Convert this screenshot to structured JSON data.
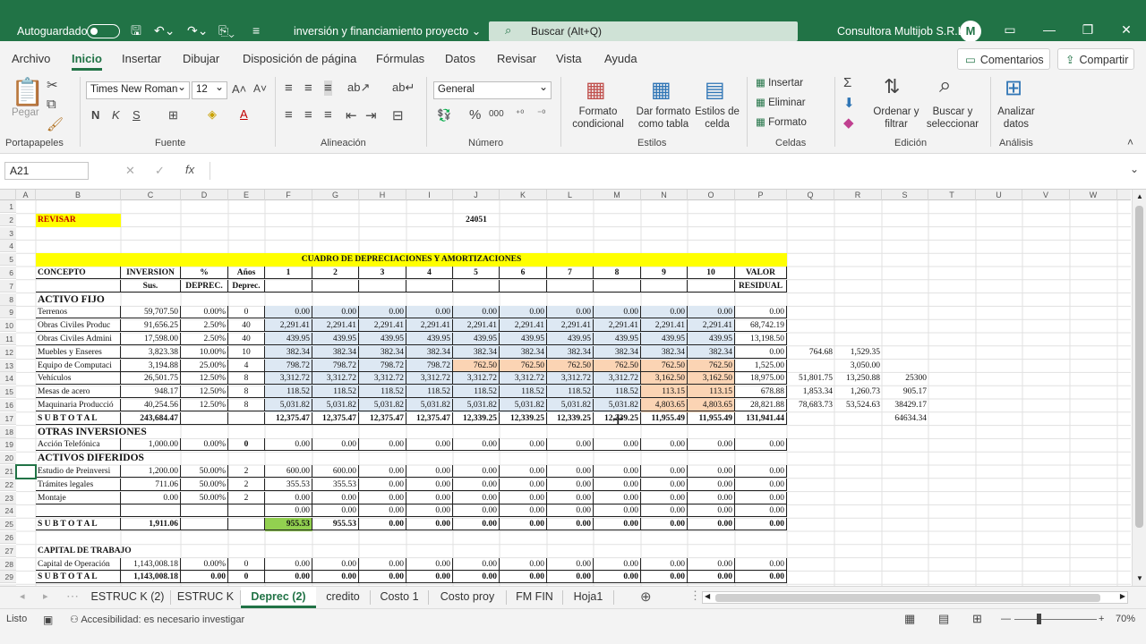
{
  "titlebar": {
    "autosave_label": "Autoguardado",
    "doc_title": "inversión y financiamiento proyecto ⌄",
    "search_placeholder": "Buscar (Alt+Q)",
    "org": "Consultora Multijob S.R.L.",
    "avatar_initial": "M"
  },
  "menu": {
    "tabs": [
      "Archivo",
      "Inicio",
      "Insertar",
      "Dibujar",
      "Disposición de página",
      "Fórmulas",
      "Datos",
      "Revisar",
      "Vista",
      "Ayuda"
    ],
    "comments": "Comentarios",
    "share": "Compartir"
  },
  "ribbon": {
    "paste": "Pegar",
    "font_name": "Times New Roman",
    "font_size": "12",
    "number_format": "General",
    "cond_format": "Formato condicional",
    "format_table": "Dar formato como tabla",
    "cell_styles": "Estilos de celda",
    "insert": "Insertar",
    "delete": "Eliminar",
    "format": "Formato",
    "sort": "Ordenar y filtrar",
    "find": "Buscar y seleccionar",
    "analyze": "Analizar datos",
    "groups": [
      "Portapapeles",
      "Fuente",
      "Alineación",
      "Número",
      "Estilos",
      "Celdas",
      "Edición",
      "Análisis"
    ]
  },
  "formula": {
    "namebox": "A21",
    "content": ""
  },
  "sheet": {
    "col_letters": [
      "A",
      "B",
      "C",
      "D",
      "E",
      "F",
      "G",
      "H",
      "I",
      "J",
      "K",
      "L",
      "M",
      "N",
      "O",
      "P",
      "Q",
      "R",
      "S",
      "T",
      "U",
      "V",
      "W"
    ],
    "row_numbers": [
      "1",
      "2",
      "3",
      "4",
      "5",
      "6",
      "7",
      "8",
      "9",
      "10",
      "11",
      "12",
      "13",
      "14",
      "15",
      "16",
      "17",
      "18",
      "19",
      "20",
      "21",
      "22",
      "23",
      "24",
      "25",
      "26",
      "27",
      "28",
      "29",
      "30"
    ],
    "revisar": "REVISAR",
    "j2": "24051",
    "title": "CUADRO DE DEPRECIACIONES Y AMORTIZACIONES",
    "header6": [
      "CONCEPTO",
      "INVERSION",
      "%",
      "Años",
      "1",
      "2",
      "3",
      "4",
      "5",
      "6",
      "7",
      "8",
      "9",
      "10",
      "VALOR"
    ],
    "header7": [
      "",
      "Sus.",
      "DEPREC.",
      "Deprec.",
      "",
      "",
      "",
      "",
      "",
      "",
      "",
      "",
      "",
      "",
      "RESIDUAL"
    ],
    "activo_fijo": "ACTIVO FIJO",
    "otras": "OTRAS INVERSIONES",
    "diferidos": "ACTIVOS DIFERIDOS",
    "capital": "CAPITAL DE TRABAJO",
    "rows": [
      {
        "r": 9,
        "cells": [
          "Terrenos",
          "59,707.50",
          "0.00%",
          "0",
          "0.00",
          "0.00",
          "0.00",
          "0.00",
          "0.00",
          "0.00",
          "0.00",
          "0.00",
          "0.00",
          "0.00",
          "0.00"
        ]
      },
      {
        "r": 10,
        "cells": [
          "Obras Civiles Produc",
          "91,656.25",
          "2.50%",
          "40",
          "2,291.41",
          "2,291.41",
          "2,291.41",
          "2,291.41",
          "2,291.41",
          "2,291.41",
          "2,291.41",
          "2,291.41",
          "2,291.41",
          "2,291.41",
          "68,742.19"
        ]
      },
      {
        "r": 11,
        "cells": [
          "Obras Civiles Admini",
          "17,598.00",
          "2.50%",
          "40",
          "439.95",
          "439.95",
          "439.95",
          "439.95",
          "439.95",
          "439.95",
          "439.95",
          "439.95",
          "439.95",
          "439.95",
          "13,198.50"
        ]
      },
      {
        "r": 12,
        "cells": [
          "Muebles y Enseres",
          "3,823.38",
          "10.00%",
          "10",
          "382.34",
          "382.34",
          "382.34",
          "382.34",
          "382.34",
          "382.34",
          "382.34",
          "382.34",
          "382.34",
          "382.34",
          "0.00"
        ],
        "extra": [
          "764.68",
          "1,529.35",
          ""
        ]
      },
      {
        "r": 13,
        "cells": [
          "Equipo de Computaci",
          "3,194.88",
          "25.00%",
          "4",
          "798.72",
          "798.72",
          "798.72",
          "798.72",
          "762.50",
          "762.50",
          "762.50",
          "762.50",
          "762.50",
          "762.50",
          "1,525.00"
        ],
        "extra": [
          "",
          "3,050.00",
          ""
        ]
      },
      {
        "r": 14,
        "cells": [
          "Vehículos",
          "26,501.75",
          "12.50%",
          "8",
          "3,312.72",
          "3,312.72",
          "3,312.72",
          "3,312.72",
          "3,312.72",
          "3,312.72",
          "3,312.72",
          "3,312.72",
          "3,162.50",
          "3,162.50",
          "18,975.00"
        ],
        "extra": [
          "51,801.75",
          "13,250.88",
          "25300"
        ]
      },
      {
        "r": 15,
        "cells": [
          "Mesas de acero",
          "948.17",
          "12.50%",
          "8",
          "118.52",
          "118.52",
          "118.52",
          "118.52",
          "118.52",
          "118.52",
          "118.52",
          "118.52",
          "113.15",
          "113.15",
          "678.88"
        ],
        "extra": [
          "1,853.34",
          "1,260.73",
          "905.17"
        ]
      },
      {
        "r": 16,
        "cells": [
          "Maquinaria Producció",
          "40,254.56",
          "12.50%",
          "8",
          "5,031.82",
          "5,031.82",
          "5,031.82",
          "5,031.82",
          "5,031.82",
          "5,031.82",
          "5,031.82",
          "5,031.82",
          "4,803.65",
          "4,803.65",
          "28,821.88"
        ],
        "extra": [
          "78,683.73",
          "53,524.63",
          "38429.17"
        ]
      },
      {
        "r": 17,
        "cells": [
          "S U B   T O T A L",
          "243,684.47",
          "",
          "",
          "12,375.47",
          "12,375.47",
          "12,375.47",
          "12,375.47",
          "12,339.25",
          "12,339.25",
          "12,339.25",
          "12,339.25",
          "11,955.49",
          "11,955.49",
          "131,941.44"
        ],
        "extra": [
          "",
          "",
          "64634.34"
        ]
      },
      {
        "r": 19,
        "cells": [
          "Acción Telefónica",
          "1,000.00",
          "0.00%",
          "0",
          "0.00",
          "0.00",
          "0.00",
          "0.00",
          "0.00",
          "0.00",
          "0.00",
          "0.00",
          "0.00",
          "0.00",
          "0.00"
        ]
      },
      {
        "r": 21,
        "cells": [
          "Estudio de Preinversi",
          "1,200.00",
          "50.00%",
          "2",
          "600.00",
          "600.00",
          "0.00",
          "0.00",
          "0.00",
          "0.00",
          "0.00",
          "0.00",
          "0.00",
          "0.00",
          "0.00"
        ]
      },
      {
        "r": 22,
        "cells": [
          "Trámites legales",
          "711.06",
          "50.00%",
          "2",
          "355.53",
          "355.53",
          "0.00",
          "0.00",
          "0.00",
          "0.00",
          "0.00",
          "0.00",
          "0.00",
          "0.00",
          "0.00"
        ]
      },
      {
        "r": 23,
        "cells": [
          "Montaje",
          "0.00",
          "50.00%",
          "2",
          "0.00",
          "0.00",
          "0.00",
          "0.00",
          "0.00",
          "0.00",
          "0.00",
          "0.00",
          "0.00",
          "0.00",
          "0.00"
        ]
      },
      {
        "r": 24,
        "cells": [
          "",
          "",
          "",
          "",
          "0.00",
          "0.00",
          "0.00",
          "0.00",
          "0.00",
          "0.00",
          "0.00",
          "0.00",
          "0.00",
          "0.00",
          "0.00"
        ]
      },
      {
        "r": 25,
        "cells": [
          "S U B   T O T A L",
          "1,911.06",
          "",
          "",
          "955.53",
          "955.53",
          "0.00",
          "0.00",
          "0.00",
          "0.00",
          "0.00",
          "0.00",
          "0.00",
          "0.00",
          "0.00"
        ]
      },
      {
        "r": 28,
        "cells": [
          "Capital de Operación",
          "1,143,008.18",
          "0.00%",
          "0",
          "0.00",
          "0.00",
          "0.00",
          "0.00",
          "0.00",
          "0.00",
          "0.00",
          "0.00",
          "0.00",
          "0.00",
          "0.00"
        ]
      },
      {
        "r": 29,
        "cells": [
          "S U B   T O T A L",
          "1,143,008.18",
          "0.00",
          "0",
          "0.00",
          "0.00",
          "0.00",
          "0.00",
          "0.00",
          "0.00",
          "0.00",
          "0.00",
          "0.00",
          "0.00",
          "0.00"
        ]
      }
    ],
    "colors": {
      "yellow": "#ffff00",
      "blue_fill": "#dde8f3",
      "orange_fill": "#fbd4b4",
      "green_fill": "#92d050",
      "red_text": "#c00000"
    }
  },
  "sheet_tabs": [
    "ESTRUC K (2)",
    "ESTRUC K",
    "Deprec (2)",
    "credito",
    "Costo 1",
    "Costo proy",
    "FM FIN",
    "Hoja1"
  ],
  "status": {
    "ready": "Listo",
    "accessibility": "Accesibilidad: es necesario investigar",
    "zoom": "70%"
  }
}
